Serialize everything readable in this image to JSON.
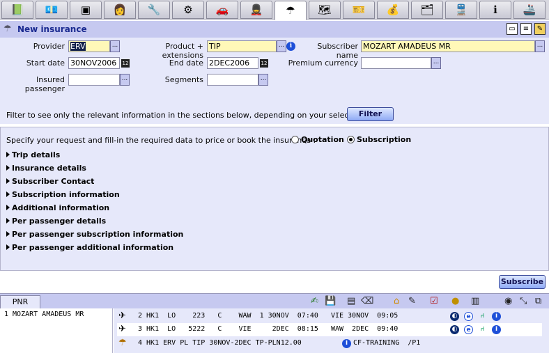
{
  "tabs": [
    {
      "icon": "book-icon",
      "glyph": "📗"
    },
    {
      "icon": "money-icon",
      "glyph": "💶"
    },
    {
      "icon": "terminal-icon",
      "glyph": "▣"
    },
    {
      "icon": "agent-icon",
      "glyph": "👩"
    },
    {
      "icon": "tools-icon",
      "glyph": "🔧"
    },
    {
      "icon": "settings-icon",
      "glyph": "⚙"
    },
    {
      "icon": "car-icon",
      "glyph": "🚗"
    },
    {
      "icon": "hotel-porter-icon",
      "glyph": "💂"
    },
    {
      "icon": "umbrella-icon",
      "glyph": "☂"
    },
    {
      "icon": "map-icon",
      "glyph": "🗺"
    },
    {
      "icon": "ticket-icon",
      "glyph": "🎫"
    },
    {
      "icon": "money-bag-icon",
      "glyph": "💰"
    },
    {
      "icon": "document-icon",
      "glyph": "🗂"
    },
    {
      "icon": "rail-icon",
      "glyph": "🚆"
    },
    {
      "icon": "info-icon",
      "glyph": "ℹ"
    },
    {
      "icon": "cruise-icon",
      "glyph": "🚢"
    }
  ],
  "active_tab": 8,
  "header": {
    "title": "New insurance"
  },
  "form": {
    "provider_label": "Provider",
    "provider_value": "ERV",
    "product_label": "Product + extensions",
    "product_value": "TIP",
    "subscriber_label": "Subscriber name",
    "subscriber_value": "MOZART AMADEUS MR",
    "start_label": "Start date",
    "start_value": "30NOV2006",
    "end_label": "End date",
    "end_value": "2DEC2006",
    "currency_label": "Premium currency",
    "currency_value": "",
    "passenger_label": "Insured passenger",
    "passenger_value": "",
    "segments_label": "Segments",
    "segments_value": "",
    "lookup_label": "...",
    "calendar_label": "12"
  },
  "filter": {
    "text": "Filter to see only the relevant information in the sections below, depending on your selected product",
    "button": "Filter"
  },
  "request": {
    "text": "Specify your request and fill-in the required data to price or book the insurance :",
    "quotation": "Quotation",
    "subscription": "Subscription",
    "selected": "subscription"
  },
  "sections": [
    "Trip details",
    "Insurance details",
    "Subscriber Contact",
    "Subscription information",
    "Additional information",
    "Per passenger details",
    "Per passenger subscription information",
    "Per passenger additional information"
  ],
  "subscribe_button": "Subscribe",
  "pnr": {
    "tab_label": "PNR",
    "passenger": "1 MOZART AMADEUS MR",
    "segments": [
      {
        "icon": "flight-icon",
        "text": "2 HK1  LO    223   C    WAW  1 30NOV  07:40   VIE 30NOV  09:05"
      },
      {
        "icon": "flight-icon",
        "text": "3 HK1  LO   5222   C    VIE     2DEC  08:15   WAW  2DEC  09:40"
      },
      {
        "icon": "umbrella-icon",
        "text": "4 HK1 ERV PL TIP 30NOV-2DEC TP-PLN12.00",
        "tail": "CF-TRAINING  /P1"
      }
    ]
  },
  "colors": {
    "form_bg": "#e6e8fa",
    "title_bg": "#c6c9f0",
    "title_text": "#1a2a90",
    "input_yellow": "#fff8b8",
    "info_blue": "#1e4fd8"
  }
}
